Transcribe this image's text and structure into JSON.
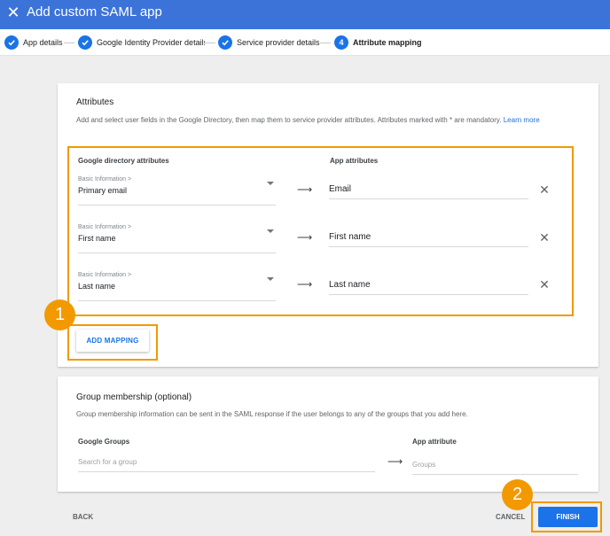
{
  "header": {
    "title": "Add custom SAML app",
    "close_icon": "close-icon"
  },
  "stepper": {
    "steps": [
      {
        "label": "App details",
        "state": "done"
      },
      {
        "label": "Google Identity Provider details",
        "state": "done"
      },
      {
        "label": "Service provider details",
        "state": "done"
      },
      {
        "label": "Attribute mapping",
        "number": "4",
        "state": "current"
      }
    ]
  },
  "attributes": {
    "title": "Attributes",
    "description": "Add and select user fields in the Google Directory, then map them to service provider attributes. Attributes marked with * are mandatory.",
    "learn_more": "Learn more",
    "col_directory": "Google directory attributes",
    "col_app": "App attributes",
    "rows": [
      {
        "category": "Basic Information >",
        "field": "Primary email",
        "app_attr": "Email"
      },
      {
        "category": "Basic Information >",
        "field": "First name",
        "app_attr": "First name"
      },
      {
        "category": "Basic Information >",
        "field": "Last name",
        "app_attr": "Last name"
      }
    ],
    "add_mapping": "ADD MAPPING"
  },
  "group": {
    "title": "Group membership (optional)",
    "description": "Group membership information can be sent in the SAML response if the user belongs to any of the groups that you add here.",
    "col_groups": "Google Groups",
    "col_attr": "App attribute",
    "search_placeholder": "Search for a group",
    "attr_placeholder": "Groups"
  },
  "footer": {
    "back": "BACK",
    "cancel": "CANCEL",
    "finish": "FINISH"
  },
  "callouts": {
    "one": "1",
    "two": "2"
  },
  "colors": {
    "header_bg": "#3b73d9",
    "accent": "#1a73e8",
    "highlight": "#f29900",
    "page_bg": "#eeeeee"
  }
}
